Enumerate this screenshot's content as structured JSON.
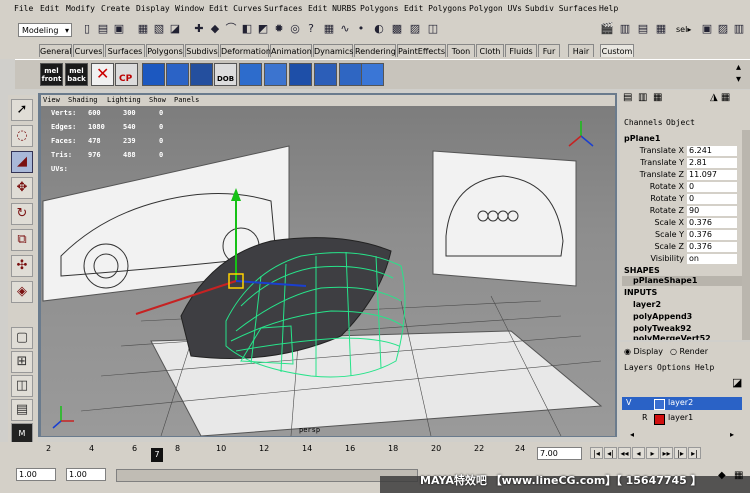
{
  "menubar": {
    "items": [
      "File",
      "Edit",
      "Modify",
      "Create",
      "Display",
      "Window",
      "Edit Curves",
      "Surfaces",
      "Edit NURBS",
      "Polygons",
      "Edit Polygons",
      "Polygon UVs",
      "Subdiv Surfaces",
      "Help"
    ]
  },
  "toolbar": {
    "mode": "Modeling",
    "sel_label": "sel▸"
  },
  "shelf_tabs": [
    "General",
    "Curves",
    "Surfaces",
    "Polygons",
    "Subdivs",
    "Deformation",
    "Animation",
    "Dynamics",
    "Rendering",
    "PaintEffects",
    "Toon",
    "Cloth",
    "Fluids",
    "Fur",
    "Hair",
    "Custom"
  ],
  "shelf": {
    "mel_front": "mel\nfront",
    "mel_back": "mel\nback",
    "cp_label": "CP",
    "dob_label": "DOB"
  },
  "panel_menu": [
    "View",
    "Shading",
    "Lighting",
    "Show",
    "Panels"
  ],
  "hud": {
    "verts": {
      "label": "Verts:",
      "a": "600",
      "b": "300",
      "c": "0"
    },
    "edges": {
      "label": "Edges:",
      "a": "1080",
      "b": "540",
      "c": "0"
    },
    "faces": {
      "label": "Faces:",
      "a": "478",
      "b": "239",
      "c": "0"
    },
    "tris": {
      "label": "Tris:",
      "a": "976",
      "b": "488",
      "c": "0"
    },
    "uvs": {
      "label": "UVs:",
      "a": "",
      "b": "",
      "c": ""
    },
    "camera": "persp"
  },
  "channel_box": {
    "tabs": [
      "Channels",
      "Object"
    ],
    "object_name": "pPlane1",
    "attributes": [
      {
        "label": "Translate X",
        "value": "6.241"
      },
      {
        "label": "Translate Y",
        "value": "2.81"
      },
      {
        "label": "Translate Z",
        "value": "11.097"
      },
      {
        "label": "Rotate X",
        "value": "0"
      },
      {
        "label": "Rotate Y",
        "value": "0"
      },
      {
        "label": "Rotate Z",
        "value": "90"
      },
      {
        "label": "Scale X",
        "value": "0.376"
      },
      {
        "label": "Scale Y",
        "value": "0.376"
      },
      {
        "label": "Scale Z",
        "value": "0.376"
      },
      {
        "label": "Visibility",
        "value": "on"
      }
    ],
    "shapes_header": "SHAPES",
    "shape_name": "pPlaneShape1",
    "inputs_header": "INPUTS",
    "inputs": [
      "layer2",
      "polyAppend3",
      "polyTweak92",
      "polyMergeVert52"
    ]
  },
  "layer_panel": {
    "display_label": "Display",
    "render_label": "Render",
    "menu": [
      "Layers",
      "Options",
      "Help"
    ],
    "layers": [
      {
        "vis": "V",
        "name": "layer2",
        "color": "#3a6fd0",
        "selected": true
      },
      {
        "vis": "",
        "type": "R",
        "name": "layer1",
        "color": "#d01010",
        "selected": false
      }
    ]
  },
  "timeline": {
    "ticks": [
      "2",
      "4",
      "6",
      "8",
      "10",
      "12",
      "14",
      "16",
      "18",
      "20",
      "22",
      "24"
    ],
    "current_frame": "7",
    "current_time": "7.00"
  },
  "range": {
    "start": "1.00",
    "end": "1.00"
  },
  "watermark": "MAYA特效吧  【www.lineCG.com】【 15647745 】"
}
